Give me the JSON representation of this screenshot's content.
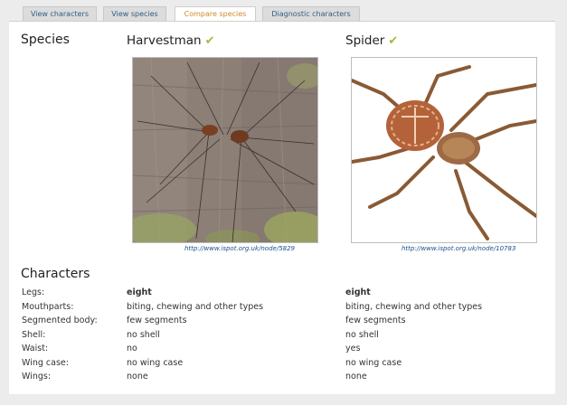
{
  "tabs": [
    {
      "label": "View characters"
    },
    {
      "label": "View species"
    },
    {
      "label": "Compare species"
    },
    {
      "label": "Diagnostic characters"
    }
  ],
  "species_heading": "Species",
  "characters_heading": "Characters",
  "tick_glyph": "✔",
  "species": [
    {
      "name": "Harvestman",
      "source": "http://www.ispot.org.uk/node/5829",
      "values": [
        "eight",
        "biting, chewing and other types",
        "few segments",
        "no shell",
        "no",
        "no wing case",
        "none"
      ]
    },
    {
      "name": "Spider",
      "source": "http://www.ispot.org.uk/node/10783",
      "values": [
        "eight",
        "biting, chewing and other types",
        "few segments",
        "no shell",
        "yes",
        "no wing case",
        "none"
      ]
    }
  ],
  "characters": [
    "Legs:",
    "Mouthparts:",
    "Segmented body:",
    "Shell:",
    "Waist:",
    "Wing case:",
    "Wings:"
  ]
}
